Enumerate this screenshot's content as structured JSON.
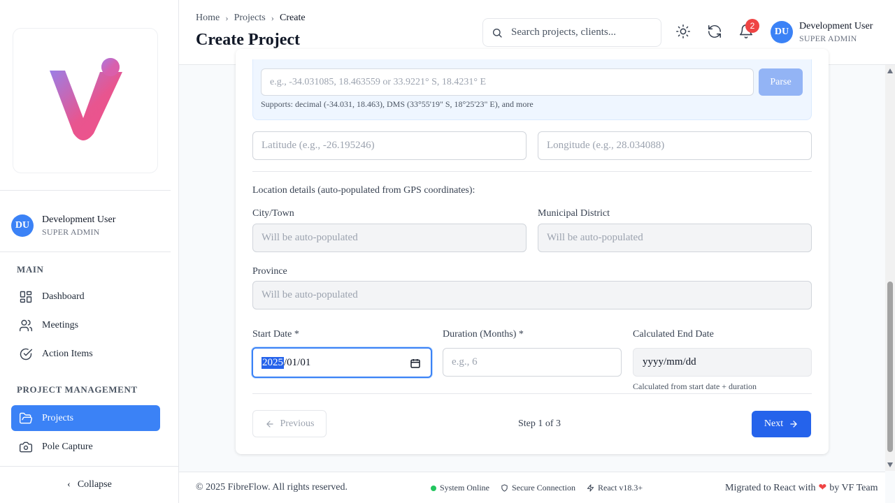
{
  "sidebar": {
    "user": {
      "initials": "DU",
      "name": "Development User",
      "role": "SUPER ADMIN"
    },
    "sections": {
      "main": "MAIN",
      "project_management": "PROJECT MANAGEMENT"
    },
    "items": [
      {
        "label": "Dashboard",
        "icon": "dashboard-icon"
      },
      {
        "label": "Meetings",
        "icon": "users-icon"
      },
      {
        "label": "Action Items",
        "icon": "check-circle-icon"
      },
      {
        "label": "Projects",
        "icon": "folder-icon",
        "active": true
      },
      {
        "label": "Pole Capture",
        "icon": "camera-icon"
      }
    ],
    "collapse_label": "Collapse"
  },
  "header": {
    "breadcrumb": [
      "Home",
      "Projects",
      "Create"
    ],
    "title": "Create Project",
    "search_placeholder": "Search projects, clients...",
    "notification_count": "2",
    "user": {
      "initials": "DU",
      "name": "Development User",
      "role": "SUPER ADMIN"
    }
  },
  "form": {
    "gps_input_placeholder": "e.g., -34.031085, 18.463559 or 33.9221° S, 18.4231° E",
    "parse_label": "Parse",
    "gps_hint": "Supports: decimal (-34.031, 18.463), DMS (33°55'19\" S, 18°25'23\" E), and more",
    "latitude_placeholder": "Latitude (e.g., -26.195246)",
    "longitude_placeholder": "Longitude (e.g., 28.034088)",
    "location_details_label": "Location details (auto-populated from GPS coordinates):",
    "city_label": "City/Town",
    "city_placeholder": "Will be auto-populated",
    "district_label": "Municipal District",
    "district_placeholder": "Will be auto-populated",
    "province_label": "Province",
    "province_placeholder": "Will be auto-populated",
    "start_date_label": "Start Date *",
    "start_date_year": "2025",
    "start_date_rest": "/01/01",
    "duration_label": "Duration (Months) *",
    "duration_placeholder": "e.g., 6",
    "end_date_label": "Calculated End Date",
    "end_date_value": "yyyy/mm/dd",
    "end_date_hint": "Calculated from start date + duration",
    "previous_label": "Previous",
    "step_text": "Step 1 of 3",
    "next_label": "Next"
  },
  "footer": {
    "copyright": "© 2025 FibreFlow. All rights reserved.",
    "status_online": "System Online",
    "secure": "Secure Connection",
    "react_version": "React v18.3+",
    "migrated_prefix": "Migrated to React with",
    "migrated_suffix": "by VF Team"
  },
  "colors": {
    "accent": "#3b82f6",
    "primary_button": "#2563eb",
    "badge": "#ef4444",
    "online": "#22c55e",
    "heart": "#ef4444"
  }
}
